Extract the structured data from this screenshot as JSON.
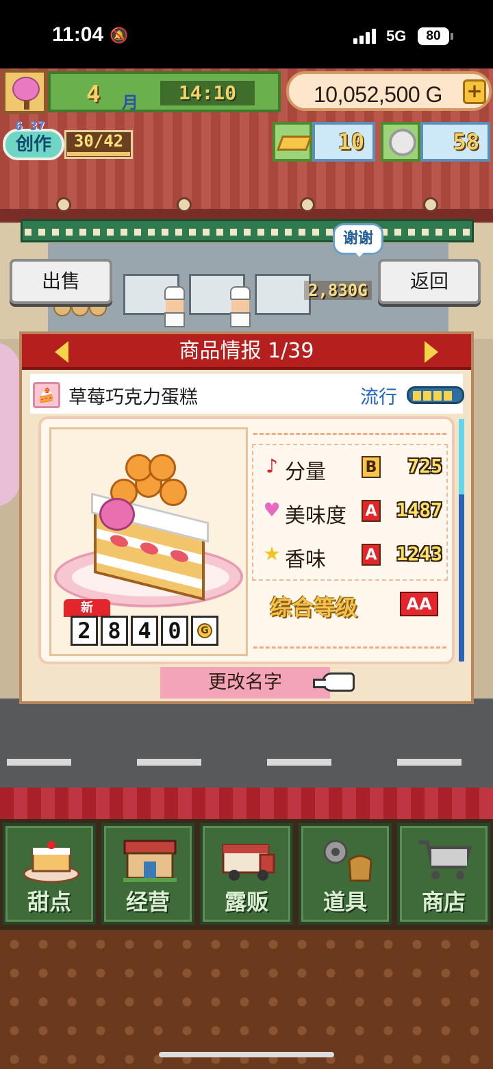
{
  "status_bar": {
    "time": "11:04",
    "network": "5G",
    "battery": "80"
  },
  "hud": {
    "month_number": "4",
    "month_label": "月",
    "clock": "14:10",
    "money": "10,052,500 G",
    "money_plus": "+",
    "create_small": "6 37",
    "create_label": "创作",
    "create_count": "30/42",
    "tickets": "10",
    "tokens": "58"
  },
  "scene": {
    "speech_bubble": "谢谢",
    "earning": "2,830G"
  },
  "panel": {
    "title": "商品情报 1/39",
    "product_name": "草莓巧克力蛋糕",
    "trend_label": "流行",
    "trend_level": 4,
    "new_tag": "新",
    "price_digits": [
      "2",
      "8",
      "4",
      "0"
    ],
    "price_unit": "G",
    "stats": [
      {
        "icon": "music-note-icon",
        "label": "分量",
        "grade": "B",
        "value": "725"
      },
      {
        "icon": "heart-icon",
        "label": "美味度",
        "grade": "A",
        "value": "1487"
      },
      {
        "icon": "star-icon",
        "label": "香味",
        "grade": "A",
        "value": "1243"
      }
    ],
    "overall_label": "综合等级",
    "overall_grade": "AA",
    "rename_button": "更改名字"
  },
  "nav": {
    "items": [
      {
        "label": "甜点",
        "icon": "cake-icon"
      },
      {
        "label": "经营",
        "icon": "shop-icon"
      },
      {
        "label": "露贩",
        "icon": "food-truck-icon"
      },
      {
        "label": "道具",
        "icon": "tools-icon"
      },
      {
        "label": "商店",
        "icon": "cart-icon"
      }
    ]
  },
  "footer": {
    "sell_button": "出售",
    "back_button": "返回"
  }
}
